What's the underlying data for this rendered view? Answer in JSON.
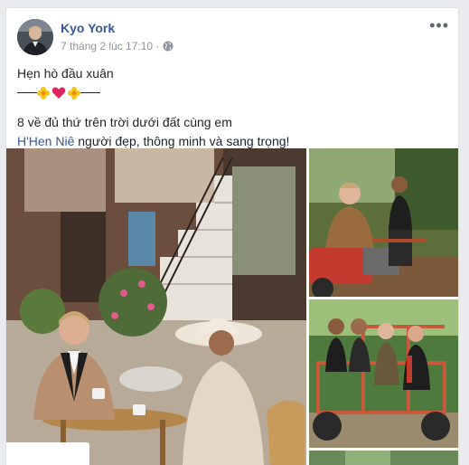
{
  "post": {
    "author": "Kyo York",
    "timestamp": "7 tháng 2 lúc 17:10 ·",
    "privacy_icon": "globe-icon",
    "more_label": "•••",
    "title": "Hẹn hò đầu xuân",
    "line1": "8 về đủ thứ trên trời dưới đất cùng em",
    "mention": "H'Hen Niê",
    "line2_rest": " người đẹp, thông minh và sang trọng!"
  },
  "icons": {
    "flower": "flower-emoji-icon",
    "heart": "red-heart-emoji-icon"
  },
  "colors": {
    "link": "#385898",
    "author": "#365899",
    "meta": "#90949c",
    "heart": "#e0245e"
  }
}
